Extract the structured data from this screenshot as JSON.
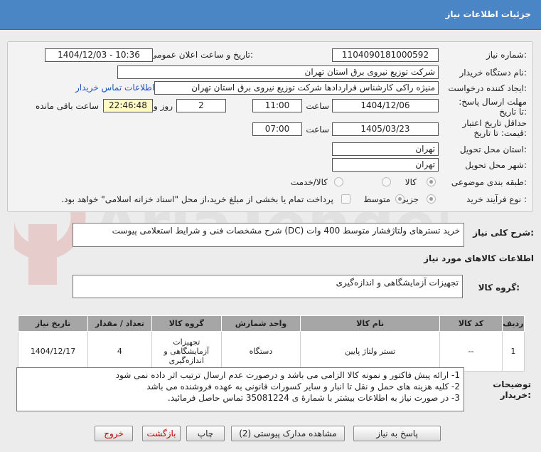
{
  "header": {
    "title": "جزئیات اطلاعات نیاز"
  },
  "fields": {
    "need_number": {
      "label": "شماره نیاز:",
      "value": "1104090181000592"
    },
    "announce_datetime": {
      "label": "تاریخ و ساعت اعلان عمومی:",
      "value": "1404/12/03 - 10:36"
    },
    "buyer_org": {
      "label": "نام دستگاه خریدار:",
      "value": "شرکت توزیع نیروی برق استان تهران"
    },
    "requester": {
      "label": "ایجاد کننده درخواست:",
      "value": "منیژه راکی کارشناس قراردادها شرکت توزیع نیروی برق استان تهران",
      "contact_link": "اطلاعات تماس خریدار"
    },
    "reply_deadline": {
      "label": "مهلت ارسال پاسخ: تا تاریخ:",
      "date": "1404/12/06",
      "time_label": "ساعت",
      "time": "11:00",
      "days": "2",
      "days_label": "روز و",
      "remaining": "22:46:48",
      "remaining_label": "ساعت باقی مانده"
    },
    "price_validity": {
      "label": "حداقل تاریخ اعتبار قیمت: تا تاریخ:",
      "date": "1405/03/23",
      "time_label": "ساعت",
      "time": "07:00"
    },
    "delivery_province": {
      "label": "استان محل تحویل:",
      "value": "تهران"
    },
    "delivery_city": {
      "label": "شهر محل تحویل:",
      "value": "تهران"
    },
    "category": {
      "label": "طبقه بندی موضوعی:",
      "options": [
        "کالا",
        "کالا/خدمت"
      ],
      "selected": "کالا"
    },
    "purchase_type": {
      "label": "نوع فرآیند خرید :",
      "options": [
        "جزیی",
        "متوسط"
      ],
      "selected": "جزیی",
      "payment_note": "پرداخت تمام یا بخشی از مبلغ خرید،از محل \"اسناد خزانه اسلامی\" خواهد بود."
    }
  },
  "general_desc": {
    "label": "شرح کلی نیاز:",
    "value": "خرید تسترهای ولتاژفشار متوسط 400 وات (DC) شرح مشخصات فنی و شرایط استعلامی پیوست"
  },
  "goods_section": {
    "title": "اطلاعات کالاهای مورد نیاز"
  },
  "goods_group": {
    "label": "گروه کالا:",
    "value": "تجهیزات آزمایشگاهی و اندازه‌گیری"
  },
  "table": {
    "columns": [
      "ردیف",
      "کد کالا",
      "نام کالا",
      "واحد شمارش",
      "گروه کالا",
      "تعداد / مقدار",
      "تاریخ نیاز"
    ],
    "rows": [
      {
        "row": "1",
        "code": "--",
        "name": "تستر ولتاژ پایین",
        "unit": "دستگاه",
        "group": "تجهیزات آزمایشگاهی و اندازه‌گیری",
        "qty": "4",
        "date": "1404/12/17"
      }
    ]
  },
  "buyer_notes": {
    "label": "توضیحات خریدار:",
    "lines": [
      "1- ارائه پیش فاکتور و نمونه کالا الزامی می باشد و درصورت عدم ارسال ترتیب اثر داده نمی شود",
      "2- کلیه هزینه های حمل و نقل تا انبار و سایر کسورات قانونی به عهده فروشنده می باشد",
      "3- در صورت نیاز به اطلاعات بیشتر با شمارهٔ ی 35081224 تماس حاصل فرمائید."
    ]
  },
  "buttons": {
    "reply": "پاسخ به نیاز",
    "attachments": "مشاهده مدارک پیوستی (2)",
    "print": "چاپ",
    "back": "بازگشت",
    "exit": "خروج"
  },
  "watermark": {
    "text": "AriaTender.neT"
  },
  "colors": {
    "header_bg": "#4a86c5",
    "link": "#1a56c2",
    "danger": "#c00000",
    "highlight": "#fff9c6"
  }
}
